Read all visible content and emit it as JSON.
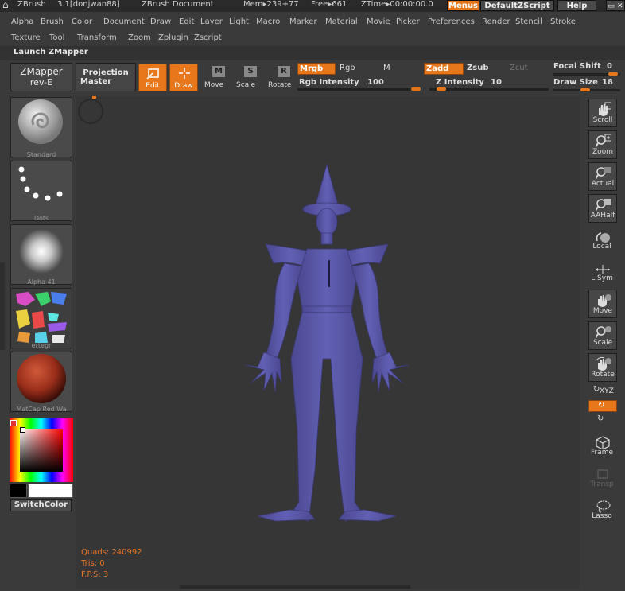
{
  "titlebar": {
    "app": "ZBrush",
    "version": "3.1[donjwan88]",
    "document": "ZBrush Document",
    "mem": "Mem▸239+77",
    "free": "Free▸661",
    "ztime": "ZTime▸00:00:00.0",
    "menus_btn": "Menus",
    "script_btn": "DefaultZScript",
    "help_btn": "Help"
  },
  "menus_row1": [
    "Alpha",
    "Brush",
    "Color",
    "Document",
    "Draw",
    "Edit",
    "Layer",
    "Light",
    "Macro",
    "Marker",
    "Material",
    "Movie",
    "Picker",
    "Preferences",
    "Render",
    "Stencil",
    "Stroke"
  ],
  "menus_row2": [
    "Texture",
    "Tool",
    "Transform",
    "Zoom",
    "Zplugin",
    "Zscript"
  ],
  "launch": "Launch ZMapper",
  "toolbar": {
    "zmapper_line1": "ZMapper",
    "zmapper_line2": "rev-E",
    "projection_line1": "Projection",
    "projection_line2": "Master",
    "edit": "Edit",
    "draw": "Draw",
    "move": "Move",
    "scale": "Scale",
    "rotate": "Rotate",
    "mrgb": "Mrgb",
    "rgb": "Rgb",
    "m": "M",
    "zadd": "Zadd",
    "zsub": "Zsub",
    "zcut": "Zcut",
    "rgb_intensity_label": "Rgb Intensity",
    "rgb_intensity_value": "100",
    "z_intensity_label": "Z Intensity",
    "z_intensity_value": "10",
    "focal_shift_label": "Focal Shift",
    "focal_shift_value": "0",
    "draw_size_label": "Draw Size",
    "draw_size_value": "18"
  },
  "left_panel": {
    "brush": "Standard",
    "stroke": "Dots",
    "alpha": "Alpha 41",
    "texture": "ertegr",
    "material": "MatCap Red Wa",
    "switch_color": "SwitchColor"
  },
  "right_shelf": [
    "Scroll",
    "Zoom",
    "Actual",
    "AAHalf",
    "Local",
    "L.Sym",
    "Move",
    "Scale",
    "Rotate",
    "XYZ",
    "",
    "",
    "Frame",
    "Transp",
    "Lasso"
  ],
  "stats": {
    "quads": "Quads: 240992",
    "tris": "Tris: 0",
    "fps": "F.P.S: 3"
  },
  "colors": {
    "accent": "#e8761a",
    "model": "#5a58a8",
    "canvas": "#363636"
  }
}
